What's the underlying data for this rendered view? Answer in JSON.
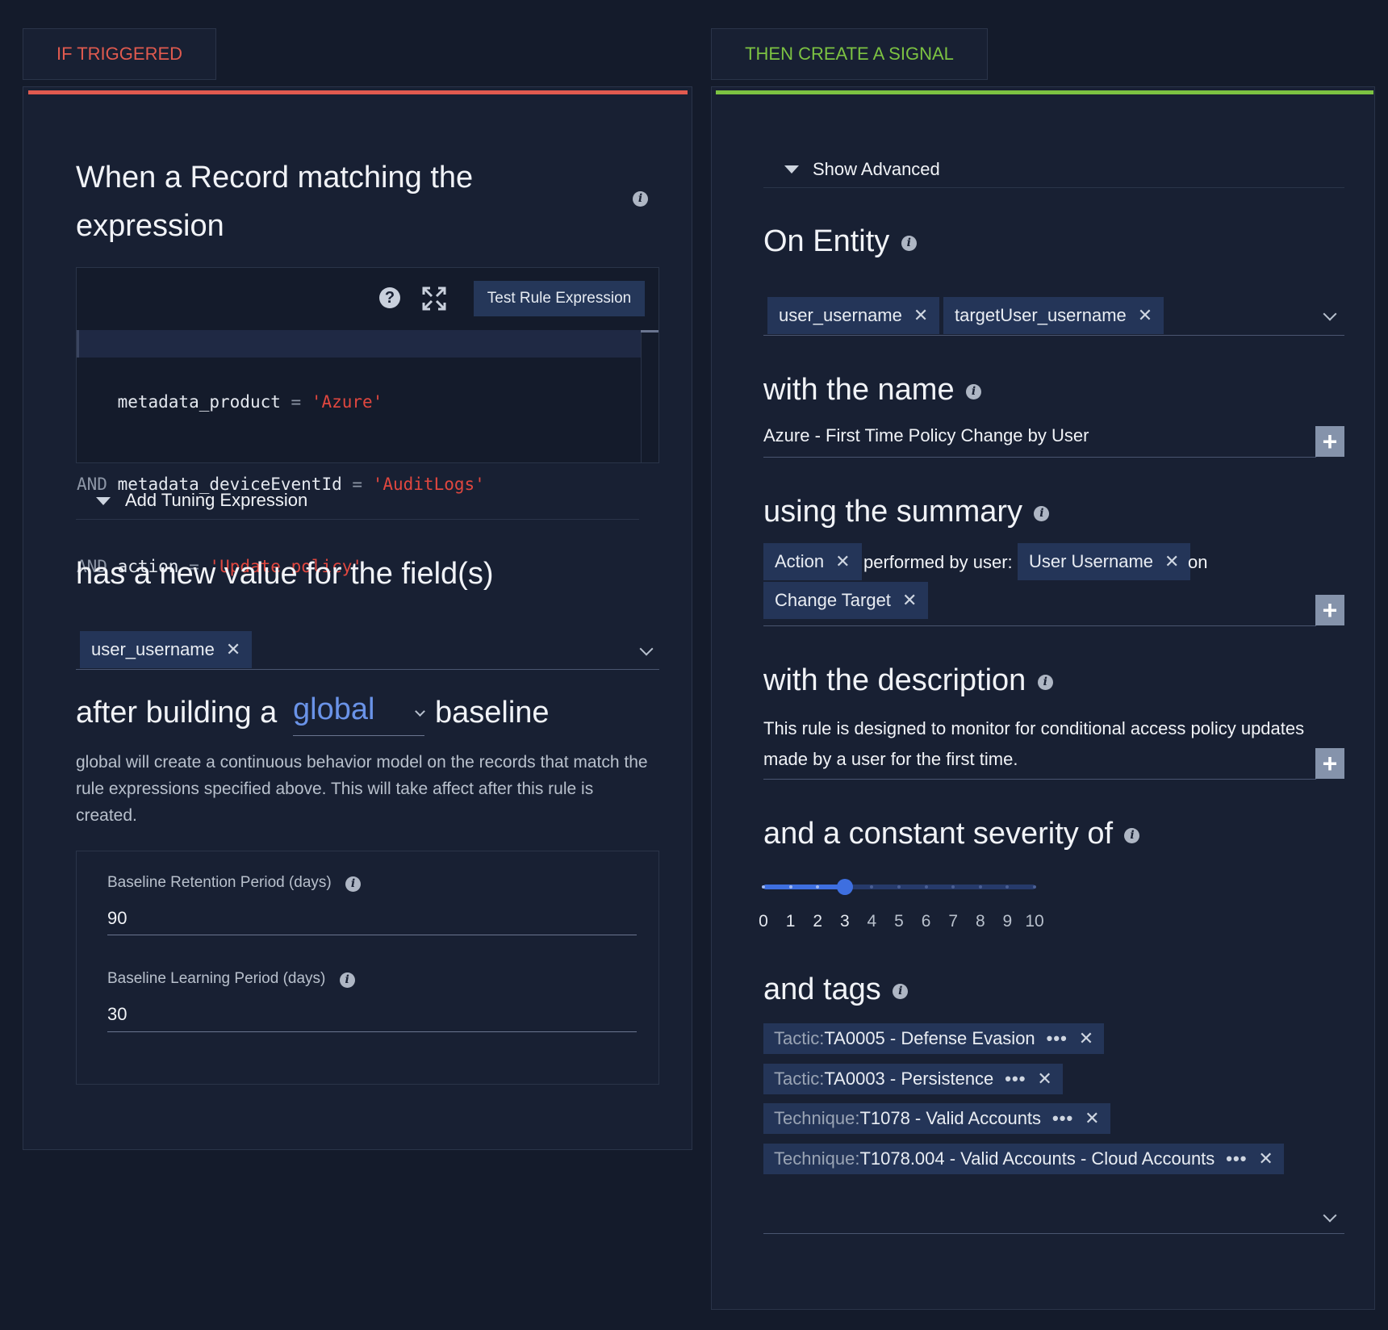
{
  "left_tab": "IF TRIGGERED",
  "right_tab": "THEN CREATE A SIGNAL",
  "colors": {
    "left_accent": "#e05a4f",
    "right_accent": "#7cc242",
    "chip_bg": "#243558"
  },
  "left": {
    "heading_line1": "When a Record matching the",
    "heading_line2": "expression",
    "test_button": "Test Rule Expression",
    "code": {
      "line1": {
        "field": "metadata_product",
        "op": "=",
        "value": "'Azure'"
      },
      "line2": {
        "kw": "AND",
        "field": "metadata_deviceEventId",
        "op": "=",
        "value": "'AuditLogs'"
      },
      "line3": {
        "kw": "AND",
        "field": "action",
        "op": "=",
        "value": "'Update policy'"
      }
    },
    "tuning_label": "Add Tuning Expression",
    "new_value_heading": "has a new value for the field(s)",
    "field_chip": "user_username",
    "baseline": {
      "prefix": "after building a",
      "selected": "global",
      "suffix": "baseline"
    },
    "baseline_desc": "global will create a continuous behavior model on the records that match the rule expressions specified above. This will take affect after this rule is created.",
    "retention_label": "Baseline Retention Period (days)",
    "retention_value": "90",
    "learning_label": "Baseline Learning Period (days)",
    "learning_value": "30"
  },
  "right": {
    "show_advanced": "Show Advanced",
    "on_entity": "On Entity",
    "entity_chips": [
      "user_username",
      "targetUser_username"
    ],
    "with_name": "with the name",
    "name_value": "Azure - First Time Policy Change by User",
    "using_summary": "using the summary",
    "summary": {
      "chip1": "Action",
      "text1": "performed by user:",
      "chip2": "User Username",
      "text2": "on",
      "chip3": "Change Target"
    },
    "with_description": "with the description",
    "description": "This rule is designed to monitor for conditional access policy updates made by a user for the first time.",
    "severity_heading": "and a constant severity of",
    "severity": {
      "value": 3,
      "min": 0,
      "max": 10,
      "ticks": [
        "0",
        "1",
        "2",
        "3",
        "4",
        "5",
        "6",
        "7",
        "8",
        "9",
        "10"
      ]
    },
    "tags_heading": "and tags",
    "tags": [
      {
        "key": "Tactic",
        "value": "TA0005 - Defense Evasion"
      },
      {
        "key": "Tactic",
        "value": "TA0003 - Persistence"
      },
      {
        "key": "Technique",
        "value": "T1078 - Valid Accounts"
      },
      {
        "key": "Technique",
        "value": "T1078.004 - Valid Accounts - Cloud Accounts"
      }
    ]
  }
}
